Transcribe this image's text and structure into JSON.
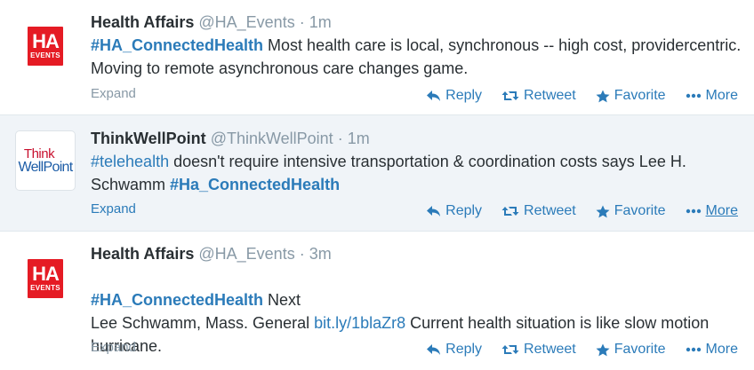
{
  "tweets": [
    {
      "author": "Health Affairs",
      "handle": "@HA_Events",
      "separator": "·",
      "time": "1m",
      "avatar": {
        "line1": "HA",
        "line2": "EVENTS"
      },
      "parts": [
        {
          "text": "#HA_ConnectedHealth",
          "link": true,
          "bold": true
        },
        {
          "text": " Most health care is local, synchronous -- high cost, providercentric. Moving to remote asynchronous care changes game.",
          "link": false
        }
      ],
      "expand": "Expand",
      "actions": {
        "reply": "Reply",
        "retweet": "Retweet",
        "favorite": "Favorite",
        "more": "More"
      }
    },
    {
      "author": "ThinkWellPoint",
      "handle": "@ThinkWellPoint",
      "separator": "·",
      "time": "1m",
      "avatar": {
        "line1": "Think",
        "line2": "WellPoint"
      },
      "parts": [
        {
          "text": "#telehealth",
          "link": true,
          "bold": false
        },
        {
          "text": " doesn't require intensive transportation & coordination costs says Lee H. Schwamm ",
          "link": false
        },
        {
          "text": "#Ha_ConnectedHealth",
          "link": true,
          "bold": true
        }
      ],
      "expand": "Expand",
      "actions": {
        "reply": "Reply",
        "retweet": "Retweet",
        "favorite": "Favorite",
        "more": "More"
      }
    },
    {
      "author": "Health Affairs",
      "handle": "@HA_Events",
      "separator": "·",
      "time": "3m",
      "avatar": {
        "line1": "HA",
        "line2": "EVENTS"
      },
      "parts": [
        {
          "text": "#HA_ConnectedHealth",
          "link": true,
          "bold": true
        },
        {
          "text": " Next\nLee Schwamm, Mass. General ",
          "link": false
        },
        {
          "text": "bit.ly/1blaZr8",
          "link": true,
          "bold": false
        },
        {
          "text": " Current health situation is like slow motion hurricane.",
          "link": false
        }
      ],
      "expand": "Expand",
      "actions": {
        "reply": "Reply",
        "retweet": "Retweet",
        "favorite": "Favorite",
        "more": "More"
      }
    }
  ],
  "colors": {
    "link": "#2b7bb9",
    "muted": "#8899a6",
    "text": "#292f33",
    "ha_red": "#e51b24",
    "highlight": "#f0f4f8"
  },
  "icons": [
    "reply-icon",
    "retweet-icon",
    "favorite-icon",
    "more-icon"
  ]
}
